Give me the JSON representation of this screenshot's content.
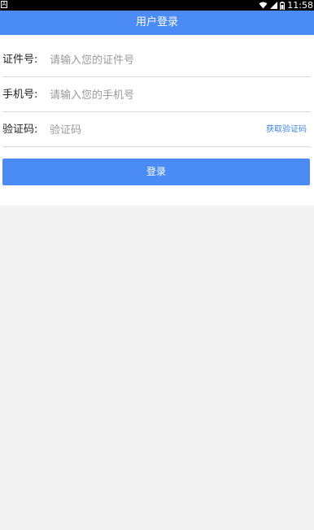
{
  "status_bar": {
    "notification_icon": "android-notification-icon",
    "wifi_icon": "wifi-icon",
    "signal_icon": "signal-icon",
    "battery_icon": "battery-icon",
    "time": "11:58"
  },
  "header": {
    "title": "用户登录"
  },
  "form": {
    "id_field": {
      "label": "证件号:",
      "placeholder": "请输入您的证件号",
      "value": ""
    },
    "phone_field": {
      "label": "手机号:",
      "placeholder": "请输入您的手机号",
      "value": ""
    },
    "code_field": {
      "label": "验证码:",
      "placeholder": "验证码",
      "value": "",
      "get_code_label": "获取验证码"
    },
    "login_label": "登录"
  },
  "colors": {
    "accent": "#4b8bf6",
    "link": "#3f86e8",
    "background": "#f3f3f3"
  }
}
